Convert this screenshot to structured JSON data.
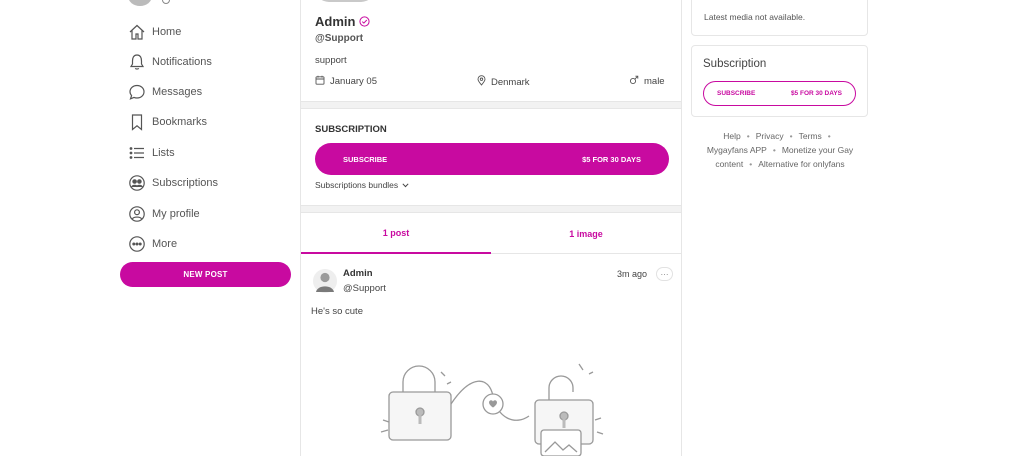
{
  "sidebar": {
    "items": [
      {
        "label": "Home",
        "icon": "home-icon"
      },
      {
        "label": "Notifications",
        "icon": "bell-icon"
      },
      {
        "label": "Messages",
        "icon": "message-icon"
      },
      {
        "label": "Bookmarks",
        "icon": "bookmark-icon"
      },
      {
        "label": "Lists",
        "icon": "list-icon"
      },
      {
        "label": "Subscriptions",
        "icon": "subscriptions-icon"
      },
      {
        "label": "My profile",
        "icon": "profile-icon"
      },
      {
        "label": "More",
        "icon": "more-icon"
      }
    ],
    "new_post_label": "NEW POST"
  },
  "profile": {
    "name": "Admin",
    "handle": "@Support",
    "bio": "support",
    "joined": "January 05",
    "location": "Denmark",
    "gender": "male"
  },
  "subscription": {
    "heading": "SUBSCRIPTION",
    "button_label": "SUBSCRIBE",
    "button_price": "$5 FOR 30 DAYS",
    "bundles_label": "Subscriptions bundles"
  },
  "tabs": [
    {
      "label": "1 post",
      "active": true
    },
    {
      "label": "1 image",
      "active": false
    }
  ],
  "post": {
    "author": "Admin",
    "handle": "@Support",
    "time": "3m ago",
    "more": "···",
    "text": "He's so cute"
  },
  "right": {
    "media_note": "Latest media not available.",
    "sub_title": "Subscription",
    "sub_button_label": "SUBSCRIBE",
    "sub_button_price": "$5 FOR 30 DAYS",
    "footer": {
      "help": "Help",
      "privacy": "Privacy",
      "terms": "Terms",
      "app": "Mygayfans APP",
      "monetize": "Monetize your Gay",
      "content": "content",
      "alternative": "Alternative for onlyfans"
    }
  },
  "colors": {
    "accent": "#c80aa0",
    "border": "#e6e6e6",
    "text": "#333333"
  }
}
